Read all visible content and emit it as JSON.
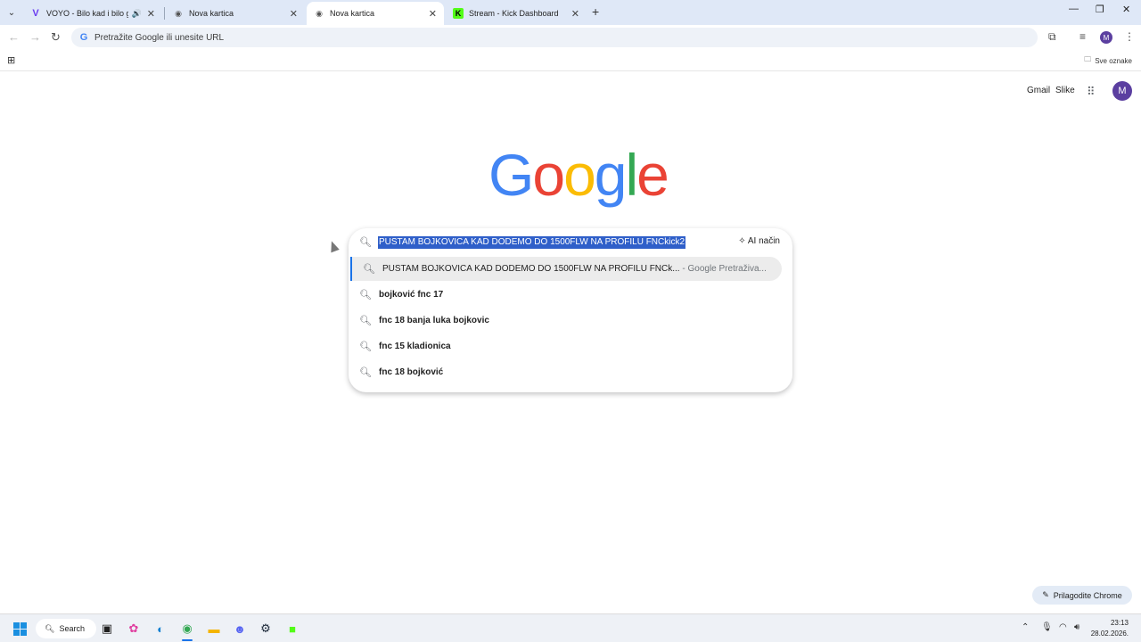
{
  "tabs": [
    {
      "title": "VOYO - Bilo kad i bilo gdje",
      "favicon": "V",
      "audio": true,
      "active": false
    },
    {
      "title": "Nova kartica",
      "favicon": "chrome-icon",
      "active": false
    },
    {
      "title": "Nova kartica",
      "favicon": "chrome-icon",
      "active": true
    },
    {
      "title": "Stream - Kick Dashboard",
      "favicon": "K",
      "active": false
    }
  ],
  "toolbar": {
    "omnibox_placeholder": "Pretražite Google ili unesite URL"
  },
  "profile_initial": "M",
  "bookmarks": {
    "all_bookmarks": "Sve oznake"
  },
  "header": {
    "gmail": "Gmail",
    "images": "Slike"
  },
  "logo": {
    "letters": [
      "G",
      "o",
      "o",
      "g",
      "l",
      "e"
    ],
    "colors": [
      "#4285f4",
      "#ea4335",
      "#fbbc05",
      "#4285f4",
      "#34a853",
      "#ea4335"
    ]
  },
  "search": {
    "query": "PUSTAM BOJKOVICA KAD DODEMO DO 1500FLW NA PROFILU FNCkick2",
    "ai_mode": "AI način",
    "suggestions": [
      {
        "text": "PUSTAM BOJKOVICA KAD DODEMO DO 1500FLW NA PROFILU FNCk...",
        "hint": " - Google Pretraživa...",
        "selected": true
      },
      {
        "text": "bojković fnc 17"
      },
      {
        "text": "fnc 18 banja luka bojkovic"
      },
      {
        "text": "fnc 15 kladionica"
      },
      {
        "text": "fnc 18 bojković"
      }
    ]
  },
  "customize_label": "Prilagodite Chrome",
  "taskbar": {
    "search_label": "Search",
    "time": "23:13",
    "date": "28.02.2026."
  }
}
